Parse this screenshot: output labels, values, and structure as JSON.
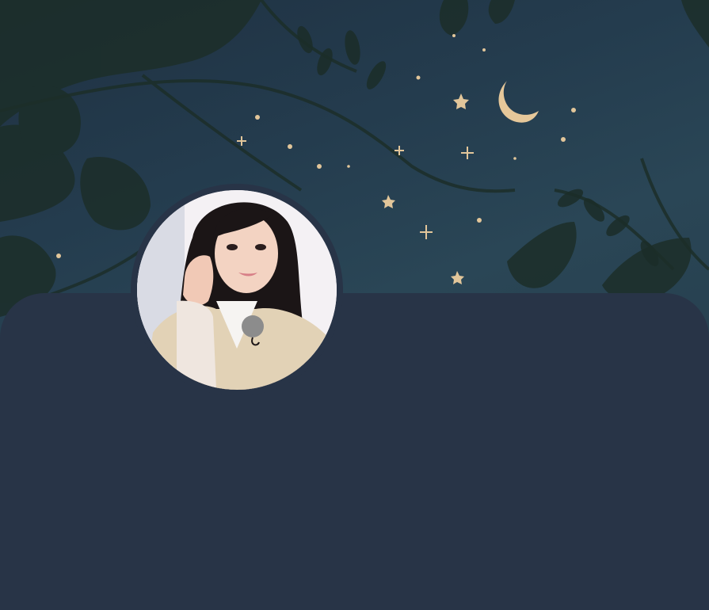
{
  "profile": {
    "banner": {
      "theme": "night-sky-foliage",
      "colors": {
        "sky": "#243c4e",
        "foliage": "#1e3026",
        "moon": "#e6c89a",
        "stars": "#e2c69a"
      }
    },
    "avatar": {
      "icon": "profile-photo",
      "ring_color": "#283447"
    },
    "card": {
      "background": "#283447"
    }
  }
}
